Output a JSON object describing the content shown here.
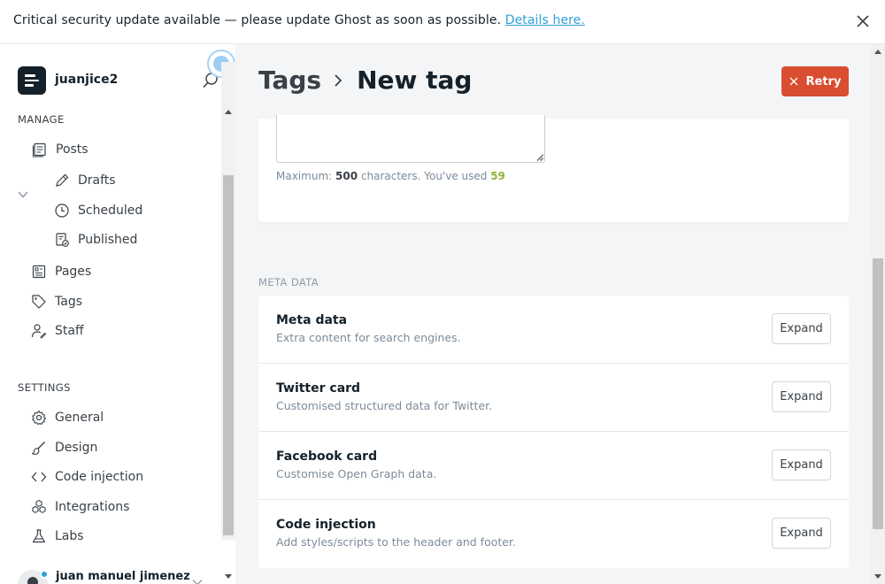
{
  "alert": {
    "message": "Critical security update available — please update Ghost as soon as possible.",
    "link_label": "Details here."
  },
  "sidebar": {
    "brand_name": "juanjice2",
    "manage_label": "MANAGE",
    "manage_items": [
      {
        "label": "Posts",
        "icon": "posts-icon"
      },
      {
        "label": "Drafts",
        "icon": "pencil-icon"
      },
      {
        "label": "Scheduled",
        "icon": "clock-icon"
      },
      {
        "label": "Published",
        "icon": "published-icon"
      },
      {
        "label": "Pages",
        "icon": "pages-icon"
      },
      {
        "label": "Tags",
        "icon": "tag-icon"
      },
      {
        "label": "Staff",
        "icon": "staff-icon"
      }
    ],
    "settings_label": "SETTINGS",
    "settings_items": [
      {
        "label": "General",
        "icon": "gear-icon"
      },
      {
        "label": "Design",
        "icon": "brush-icon"
      },
      {
        "label": "Code injection",
        "icon": "code-icon"
      },
      {
        "label": "Integrations",
        "icon": "integrations-icon"
      },
      {
        "label": "Labs",
        "icon": "flask-icon"
      }
    ],
    "user_name": "juan manuel jimenez"
  },
  "header": {
    "breadcrumb_parent": "Tags",
    "breadcrumb_current": "New tag",
    "retry_label": "Retry"
  },
  "description": {
    "max_prefix": "Maximum:",
    "max_value": "500",
    "used_text": "characters. You've used",
    "used_value": "59"
  },
  "meta": {
    "heading": "META DATA",
    "expand_label": "Expand",
    "rows": [
      {
        "title": "Meta data",
        "description": "Extra content for search engines."
      },
      {
        "title": "Twitter card",
        "description": "Customised structured data for Twitter."
      },
      {
        "title": "Facebook card",
        "description": "Customise Open Graph data."
      },
      {
        "title": "Code injection",
        "description": "Add styles/scripts to the header and footer."
      }
    ]
  },
  "colors": {
    "accent": "#30a0d8",
    "retry": "#d94d31",
    "used_count": "#8fb33b"
  }
}
